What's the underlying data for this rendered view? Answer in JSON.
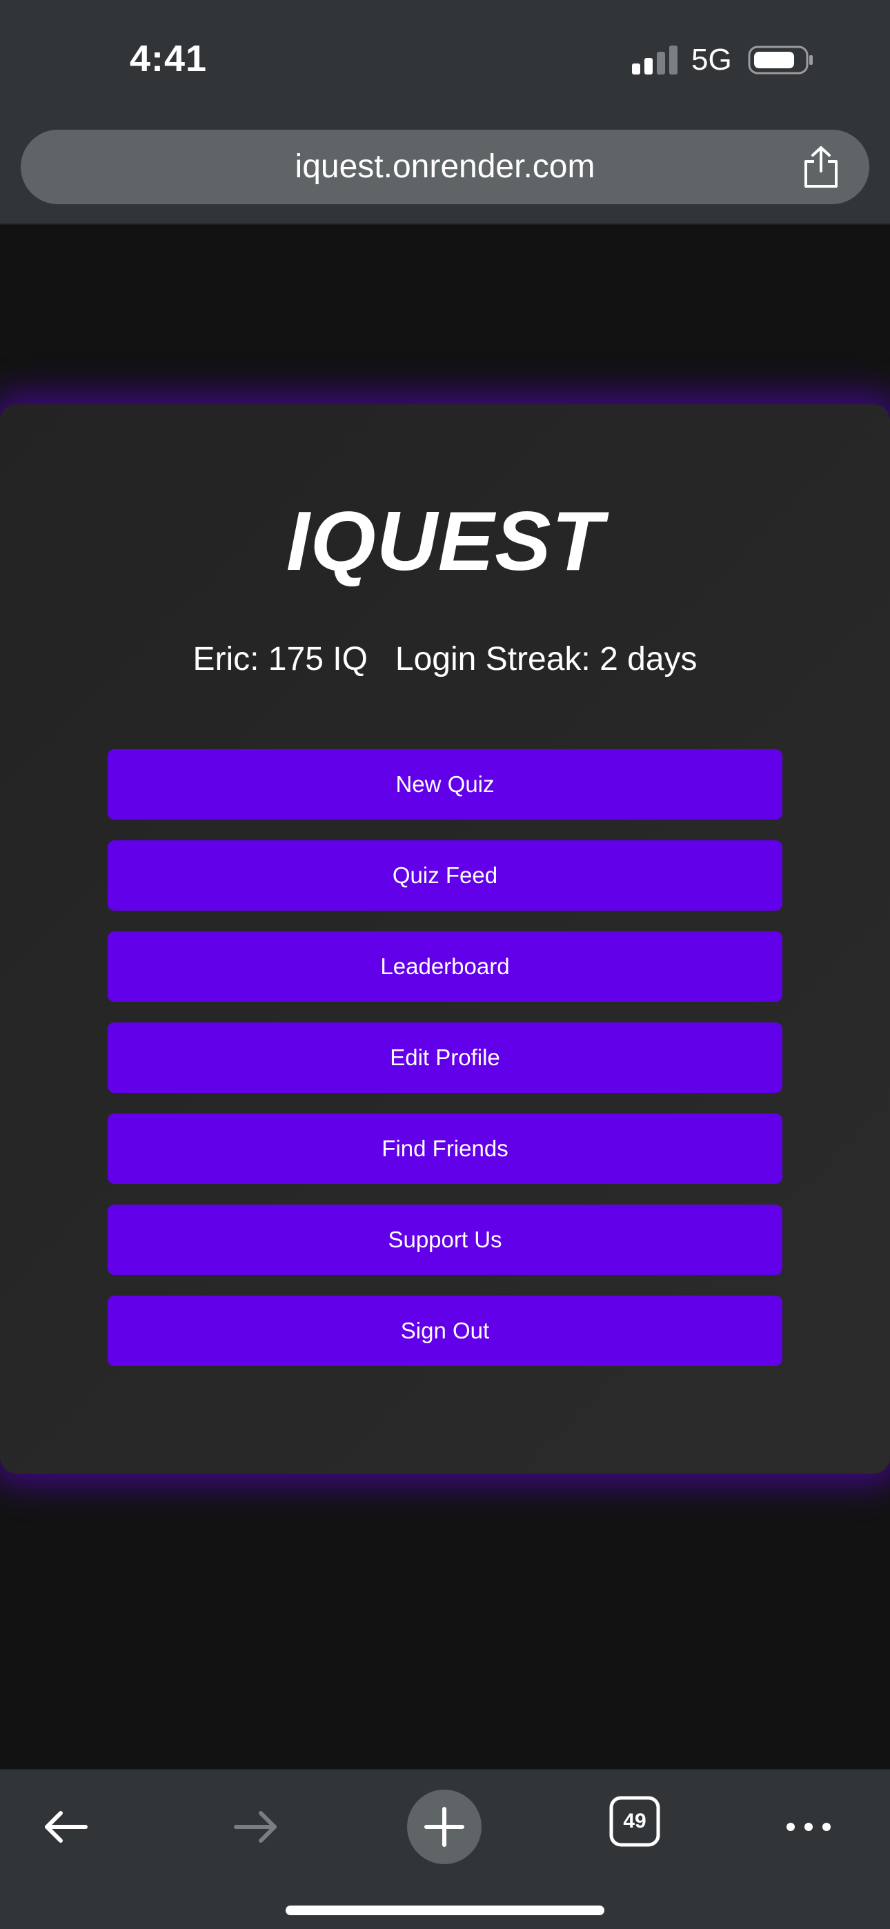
{
  "status_bar": {
    "time": "4:41",
    "network": "5G"
  },
  "browser": {
    "url": "iquest.onrender.com",
    "tab_count": "49"
  },
  "app": {
    "title": "IQUEST",
    "user_iq": "Eric: 175 IQ",
    "login_streak": "Login Streak: 2 days",
    "menu": [
      {
        "label": "New Quiz"
      },
      {
        "label": "Quiz Feed"
      },
      {
        "label": "Leaderboard"
      },
      {
        "label": "Edit Profile"
      },
      {
        "label": "Find Friends"
      },
      {
        "label": "Support Us"
      },
      {
        "label": "Sign Out"
      }
    ]
  },
  "icons": {
    "share": "share-icon",
    "back": "back-arrow-icon",
    "forward": "forward-arrow-icon",
    "new_tab": "plus-icon",
    "tabs": "tabs-icon",
    "more": "more-icon"
  },
  "colors": {
    "accent": "#6200ea",
    "card_bg": "#262626",
    "page_bg": "#121212",
    "chrome_bg": "#323538"
  }
}
